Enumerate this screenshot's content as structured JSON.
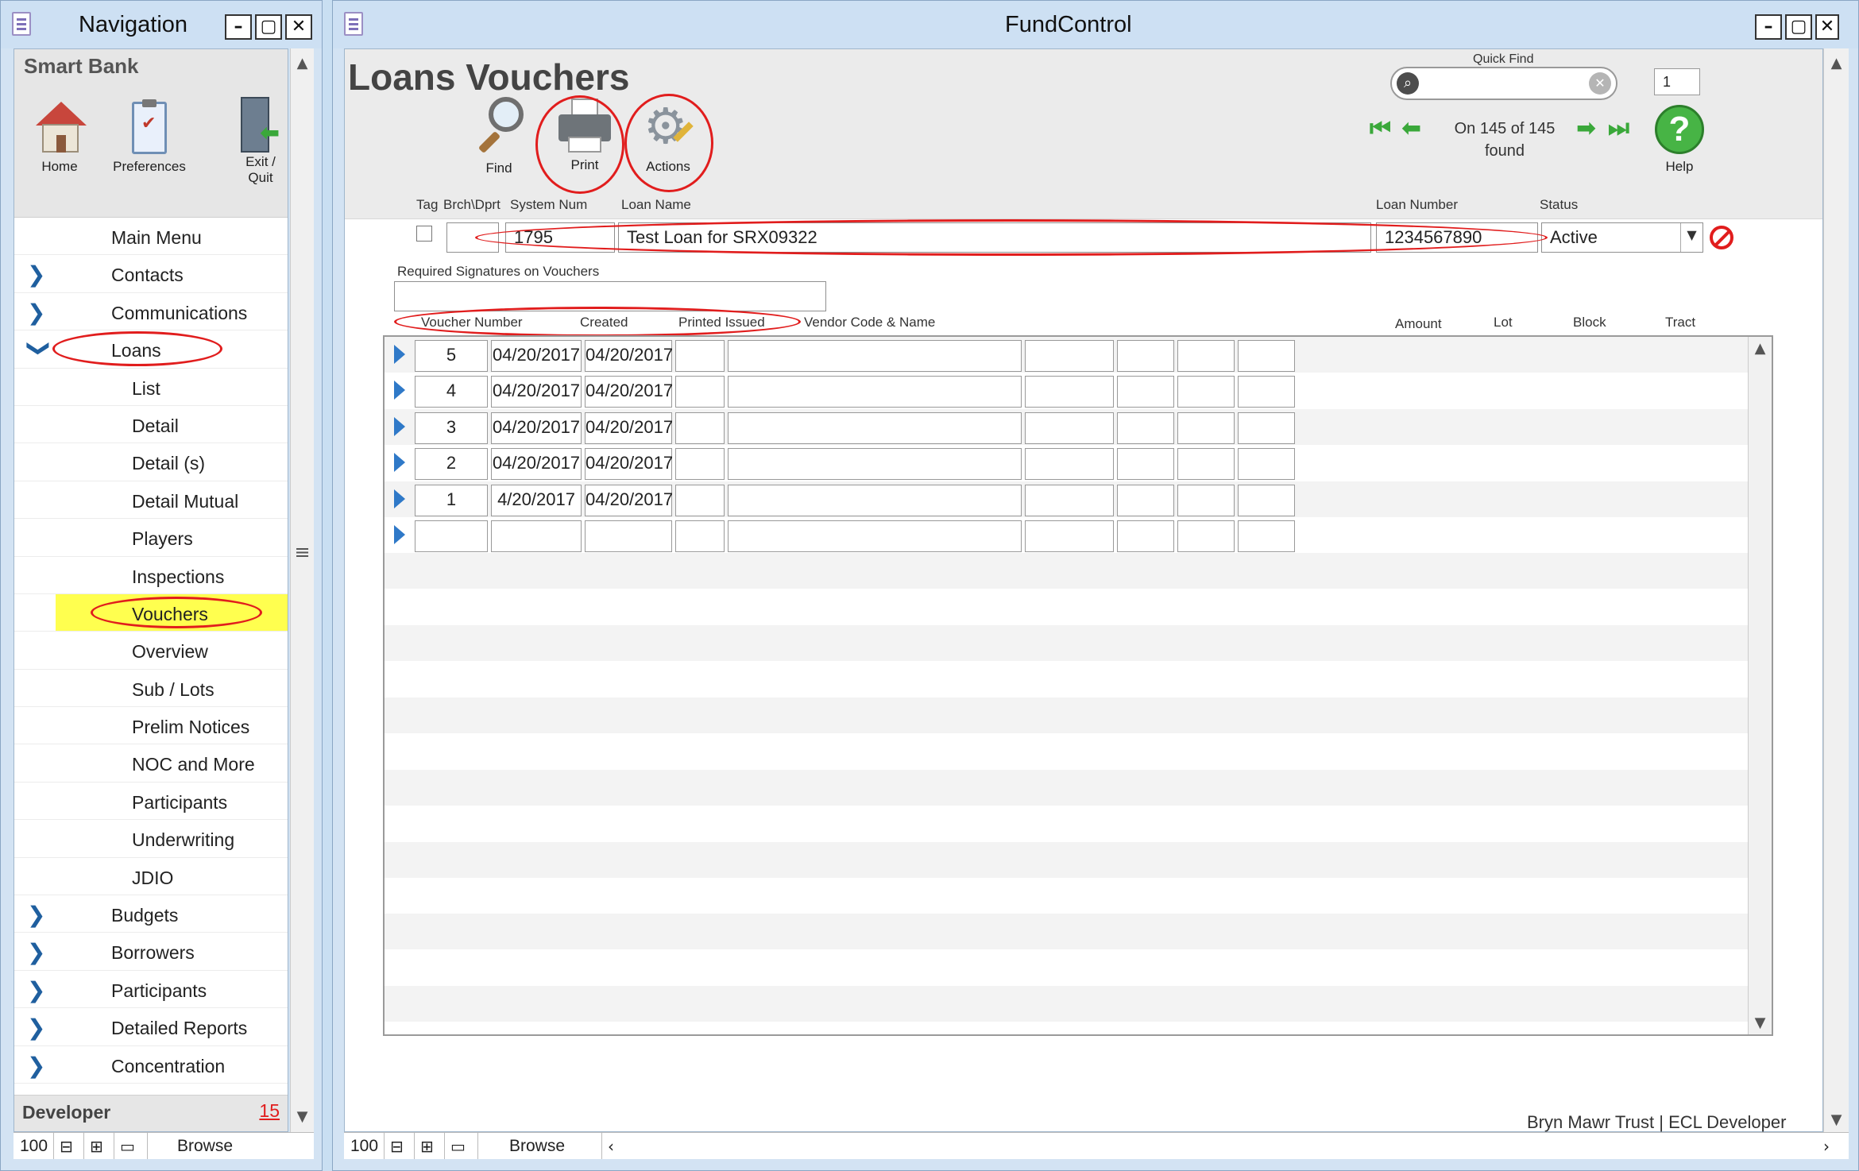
{
  "nav_window": {
    "title": "Navigation",
    "brand": "Smart Bank",
    "toolbar": [
      {
        "label": "Home",
        "icon": "home-icon"
      },
      {
        "label": "Preferences",
        "icon": "clipboard-icon"
      },
      {
        "label": "Exit / Quit",
        "icon": "exit-door-icon"
      }
    ],
    "items": [
      {
        "label": "Main Menu",
        "level": 1,
        "expandable": false
      },
      {
        "label": "Contacts",
        "level": 1,
        "expandable": true
      },
      {
        "label": "Communications",
        "level": 1,
        "expandable": true
      },
      {
        "label": "Loans",
        "level": 1,
        "expandable": true,
        "expanded": true
      },
      {
        "label": "List",
        "level": 2
      },
      {
        "label": "Detail",
        "level": 2
      },
      {
        "label": "Detail (s)",
        "level": 2
      },
      {
        "label": "Detail Mutual",
        "level": 2
      },
      {
        "label": "Players",
        "level": 2
      },
      {
        "label": "Inspections",
        "level": 2
      },
      {
        "label": "Vouchers",
        "level": 2,
        "selected": true
      },
      {
        "label": "Overview",
        "level": 2
      },
      {
        "label": "Sub / Lots",
        "level": 2
      },
      {
        "label": "Prelim Notices",
        "level": 2
      },
      {
        "label": "NOC and More",
        "level": 2
      },
      {
        "label": "Participants",
        "level": 2
      },
      {
        "label": "Underwriting",
        "level": 2
      },
      {
        "label": "JDIO",
        "level": 2
      },
      {
        "label": "Budgets",
        "level": 1,
        "expandable": true
      },
      {
        "label": "Borrowers",
        "level": 1,
        "expandable": true
      },
      {
        "label": "Participants",
        "level": 1,
        "expandable": true
      },
      {
        "label": "Detailed Reports",
        "level": 1,
        "expandable": true
      },
      {
        "label": "Concentration",
        "level": 1,
        "expandable": true
      }
    ],
    "footer": {
      "label": "Developer",
      "count": "15"
    },
    "status": {
      "zoom": "100",
      "mode": "Browse"
    }
  },
  "fc_window": {
    "title": "FundControl",
    "page_title": "Loans Vouchers",
    "tools": {
      "find": "Find",
      "print": "Print",
      "actions": "Actions",
      "help": "Help"
    },
    "quick_find": {
      "label": "Quick Find",
      "value": ""
    },
    "record_box": "1",
    "found_line1": "On 145 of 145",
    "found_line2": "found",
    "labels": {
      "tag": "Tag",
      "brch": "Brch\\Dprt",
      "sysnum": "System Num",
      "loan_name": "Loan Name",
      "loan_number": "Loan Number",
      "status": "Status",
      "req_sig": "Required Signatures on Vouchers"
    },
    "record": {
      "brch": "",
      "system_num": "1795",
      "loan_name": "Test Loan for SRX09322",
      "loan_number": "1234567890",
      "status": "Active",
      "required_signatures": ""
    },
    "columns": {
      "voucher_number": "Voucher Number",
      "created": "Created",
      "printed_issued": "Printed Issued",
      "vendor": "Vendor Code & Name",
      "amount": "Amount",
      "lot": "Lot",
      "block": "Block",
      "tract": "Tract"
    },
    "rows": [
      {
        "voucher": "5",
        "created": "04/20/2017",
        "printed": "04/20/2017"
      },
      {
        "voucher": "4",
        "created": "04/20/2017",
        "printed": "04/20/2017"
      },
      {
        "voucher": "3",
        "created": "04/20/2017",
        "printed": "04/20/2017"
      },
      {
        "voucher": "2",
        "created": "04/20/2017",
        "printed": "04/20/2017"
      },
      {
        "voucher": "1",
        "created": "4/20/2017",
        "printed": "04/20/2017"
      },
      {
        "voucher": "",
        "created": "",
        "printed": ""
      }
    ],
    "footer_text": "Bryn Mawr Trust | ECL Developer",
    "status": {
      "zoom": "100",
      "mode": "Browse"
    }
  },
  "colors": {
    "highlight": "#ffff4f",
    "annotation": "#e11d1d",
    "chevron": "#1f5f9f"
  }
}
